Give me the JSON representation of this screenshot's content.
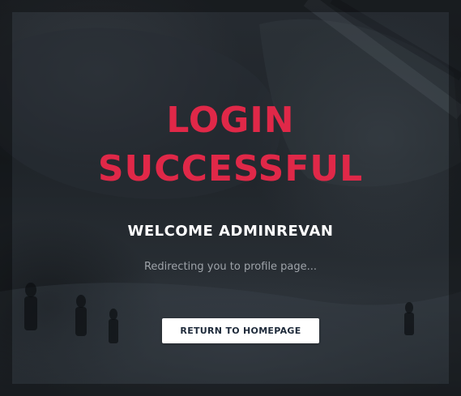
{
  "page": {
    "title_line_1": "LOGIN",
    "title_line_2": "SUCCESSFUL",
    "welcome": "WELCOME ADMINREVAN",
    "redirect_message": "Redirecting you to profile page...",
    "home_button_label": "RETURN TO HOMEPAGE"
  },
  "colors": {
    "accent": "#e02848",
    "background": "#1f2429",
    "button_bg": "#ffffff",
    "button_text": "#1e2a3a",
    "muted_text": "#9ea3a9"
  }
}
